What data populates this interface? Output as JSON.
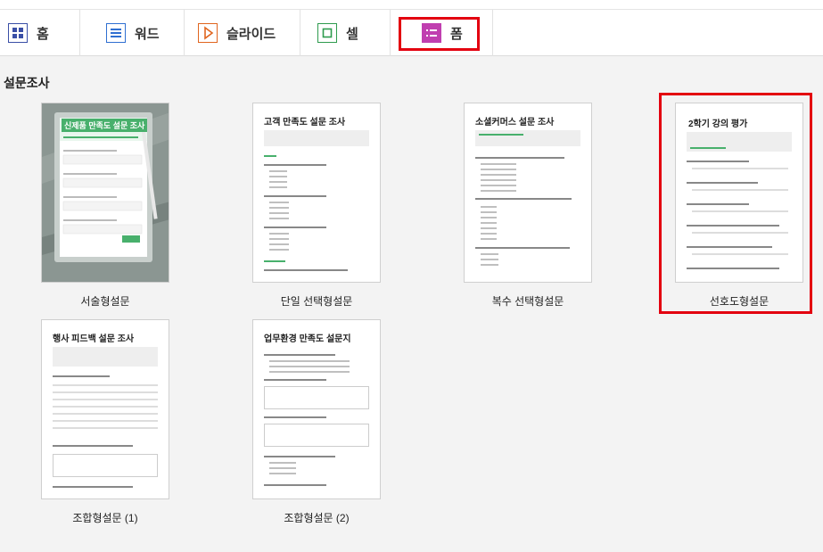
{
  "tabs": [
    {
      "label": "홈",
      "icon": "home-grid-icon",
      "color": "#3a4fa6"
    },
    {
      "label": "워드",
      "icon": "word-doc-icon",
      "color": "#2f6fd1"
    },
    {
      "label": "슬라이드",
      "icon": "slide-play-icon",
      "color": "#e0651f"
    },
    {
      "label": "셀",
      "icon": "cell-square-icon",
      "color": "#2e9b4e"
    },
    {
      "label": "폼",
      "icon": "form-list-icon",
      "color": "#c03fb0"
    }
  ],
  "section": {
    "title": "설문조사"
  },
  "templates": [
    {
      "label": "서술형설문",
      "thumb_title": "신제품 만족도 설문 조사"
    },
    {
      "label": "단일 선택형설문",
      "thumb_title": "고객 만족도 설문 조사"
    },
    {
      "label": "복수 선택형설문",
      "thumb_title": "소셜커머스 설문 조사"
    },
    {
      "label": "선호도형설문",
      "thumb_title": "2학기 강의 평가"
    },
    {
      "label": "조합형설문 (1)",
      "thumb_title": "행사 피드백 설문 조사"
    },
    {
      "label": "조합형설문 (2)",
      "thumb_title": "업무환경 만족도 설문지"
    }
  ],
  "colors": {
    "highlight": "#e3000f",
    "accent_green": "#48b06c"
  }
}
